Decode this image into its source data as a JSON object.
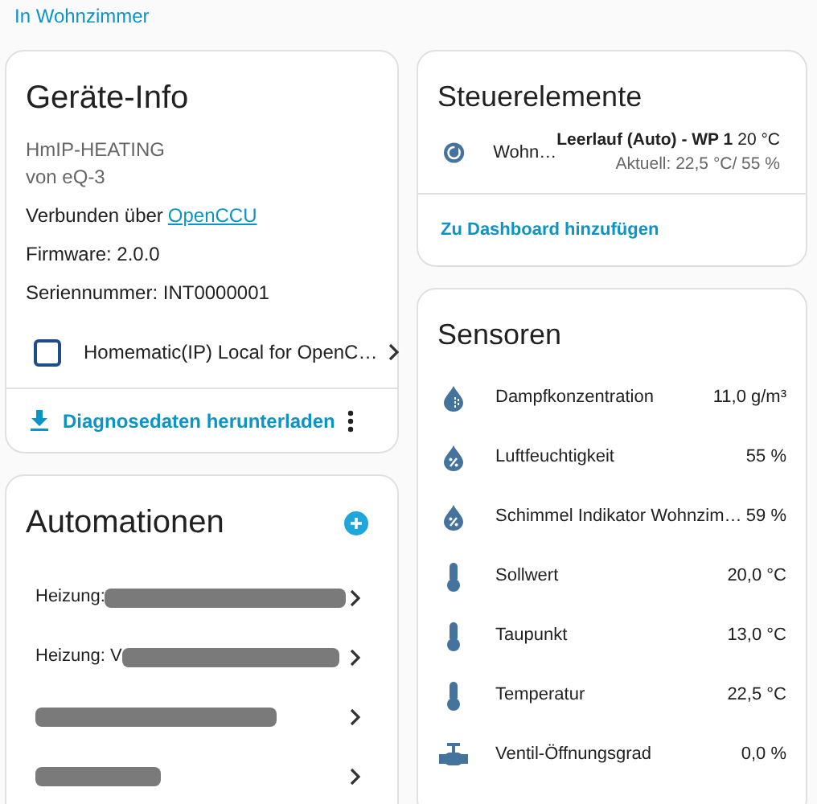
{
  "area_link": "In Wohnzimmer",
  "device_info": {
    "title": "Geräte-Info",
    "model": "HmIP-HEATING",
    "manufacturer": "von eQ-3",
    "connected_label": "Verbunden über",
    "connected_link": "OpenCCU",
    "firmware": "Firmware: 2.0.0",
    "serial": "Seriennummer: INT0000001",
    "integration": "Homematic(IP) Local for OpenC…",
    "download": "Diagnosedaten herunterladen"
  },
  "automations": {
    "title": "Automationen",
    "items": [
      {
        "label": "Heizung:",
        "redacted": true
      },
      {
        "label": "Heizung: V",
        "redacted": true
      },
      {
        "redacted": true
      },
      {
        "redacted": true
      }
    ]
  },
  "controls": {
    "title": "Steuerelemente",
    "entity": "Wohn…",
    "state": "Leerlauf (Auto) - WP 1",
    "target": "20 °C",
    "current": "Aktuell: 22,5 °C/ 55 %",
    "add_link": "Zu Dashboard hinzufügen"
  },
  "sensors": {
    "title": "Sensoren",
    "items": [
      {
        "kind": "vapor",
        "name": "Dampfkonzentration",
        "value": "11,0 g/m³"
      },
      {
        "kind": "humidity",
        "name": "Luftfeuchtigkeit",
        "value": "55 %"
      },
      {
        "kind": "humidity",
        "name": "Schimmel Indikator Wohnzim…",
        "value": "59 %"
      },
      {
        "kind": "thermometer",
        "name": "Sollwert",
        "value": "20,0 °C"
      },
      {
        "kind": "thermometer",
        "name": "Taupunkt",
        "value": "13,0 °C"
      },
      {
        "kind": "thermometer",
        "name": "Temperatur",
        "value": "22,5 °C"
      },
      {
        "kind": "valve",
        "name": "Ventil-Öffnungsgrad",
        "value": "0,0 %"
      }
    ]
  }
}
